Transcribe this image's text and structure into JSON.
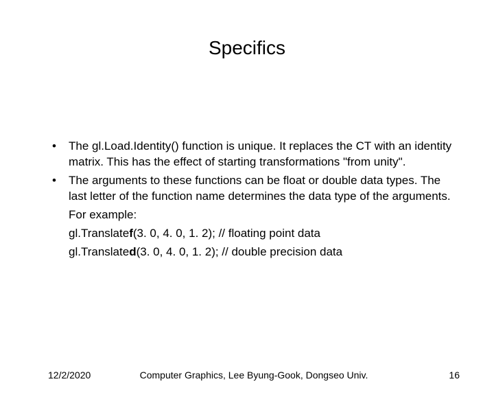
{
  "title": "Specifics",
  "bullets": [
    {
      "marker": "•",
      "text": "The gl.Load.Identity() function is unique. It replaces the CT with an identity matrix. This has the effect of starting transformations \"from unity\"."
    },
    {
      "marker": "•",
      "text": "The arguments to these functions can be float or double data types. The last letter of the function name determines the data type of the arguments."
    }
  ],
  "cont": {
    "l0": "For example:",
    "l1a": "gl.Translate",
    "l1b": "f",
    "l1c": "(3. 0, 4. 0, 1. 2); // floating point data",
    "l2a": "gl.Translate",
    "l2b": "d",
    "l2c": "(3. 0, 4. 0, 1. 2); // double precision data"
  },
  "footer": {
    "date": "12/2/2020",
    "center": "Computer Graphics, Lee Byung-Gook, Dongseo Univ.",
    "page": "16"
  }
}
